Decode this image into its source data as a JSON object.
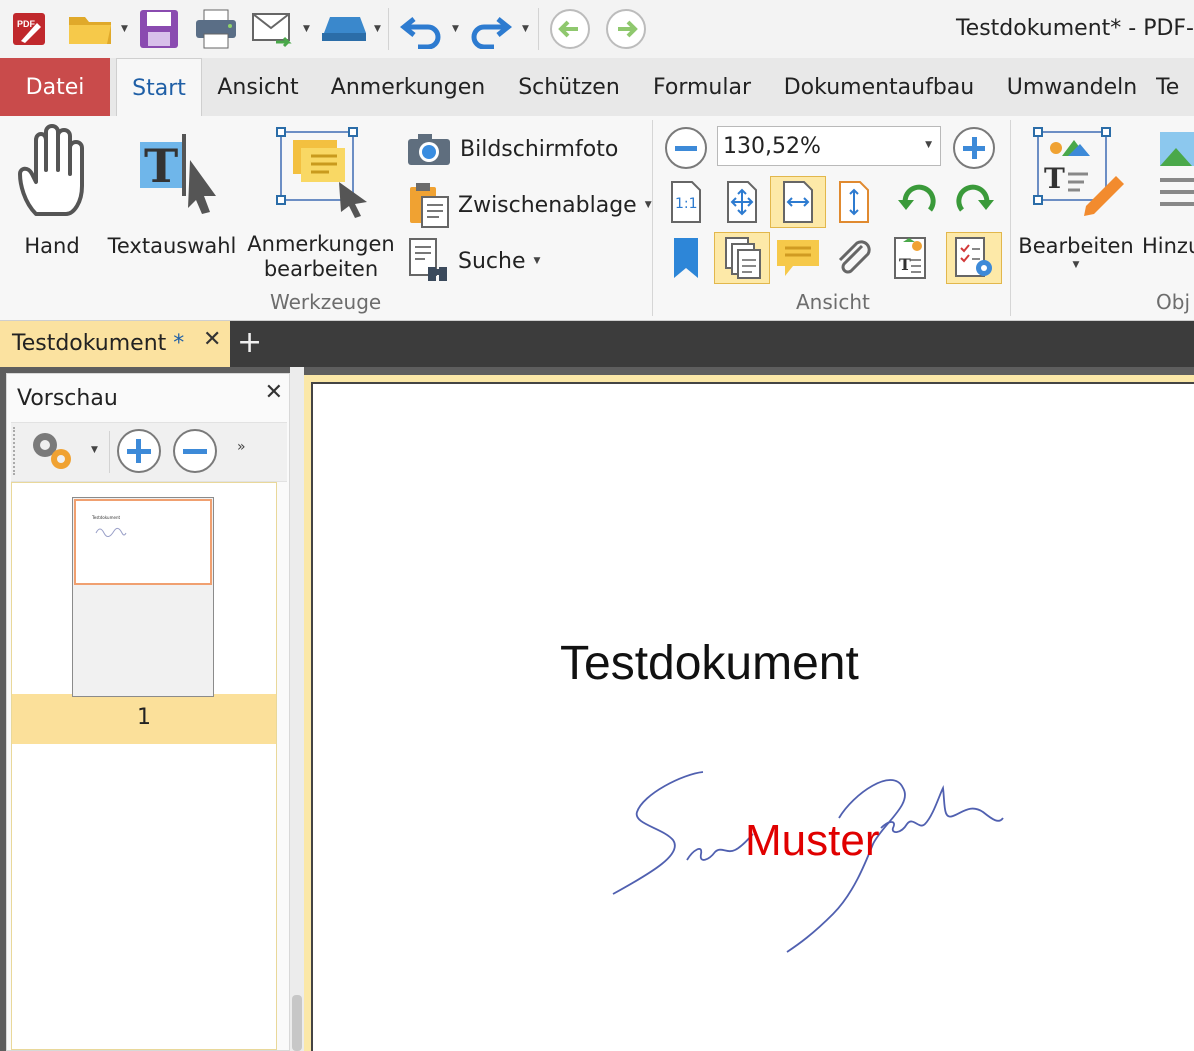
{
  "window": {
    "title": "Testdokument* - PDF-"
  },
  "ribbon_tabs": [
    "Datei",
    "Start",
    "Ansicht",
    "Anmerkungen",
    "Schützen",
    "Formular",
    "Dokumentaufbau",
    "Umwandeln",
    "Te"
  ],
  "groups": {
    "werkzeuge": {
      "label": "Werkzeuge",
      "hand": "Hand",
      "textauswahl": "Textauswahl",
      "anmerkungen_1": "Anmerkungen",
      "anmerkungen_2": "bearbeiten",
      "bildschirmfoto": "Bildschirmfoto",
      "zwischenablage": "Zwischenablage",
      "suche": "Suche"
    },
    "ansicht": {
      "label": "Ansicht",
      "zoom": "130,52%"
    },
    "objekte": {
      "bearbeiten": "Bearbeiten",
      "hinzu": "Hinzu",
      "label": "Obj"
    }
  },
  "doc_tab": {
    "label": "Testdokument",
    "modified": "*"
  },
  "preview": {
    "title": "Vorschau",
    "page_number": "1",
    "thumb_text": "Testdokument"
  },
  "document": {
    "title": "Testdokument",
    "stamp": "Muster"
  },
  "colors": {
    "datei": "#c94b4b",
    "accent": "#1f5fa6",
    "selection": "#fbe09a",
    "stamp": "#e00000",
    "signature": "#5060b0"
  }
}
